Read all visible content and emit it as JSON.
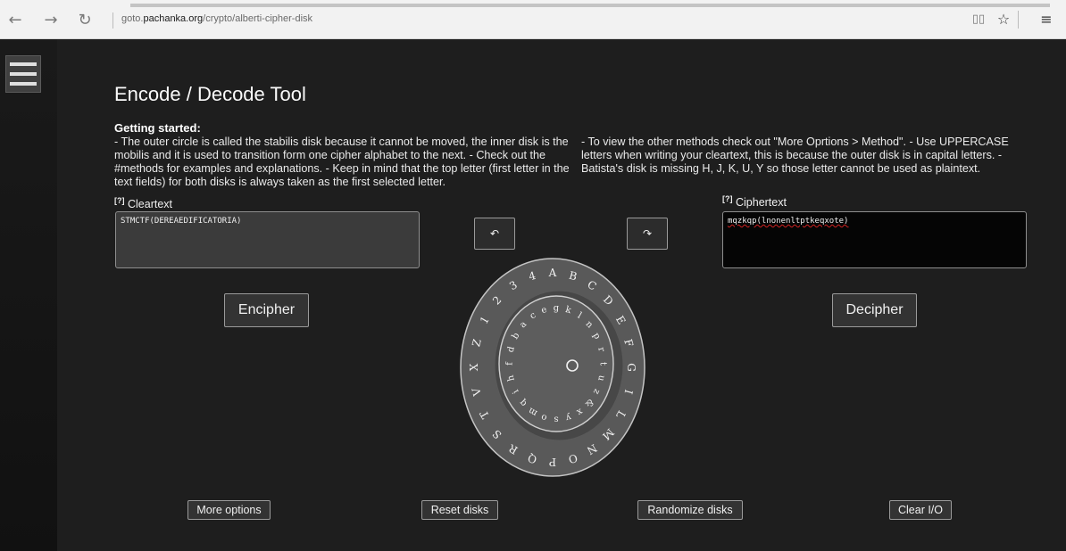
{
  "browser": {
    "url_prefix": "goto.",
    "url_domain": "pachanka.org",
    "url_path": "/crypto/alberti-cipher-disk",
    "back_icon": "←",
    "forward_icon": "→",
    "refresh_icon": "↻",
    "reading_icon": "📖",
    "favorite_icon": "☆",
    "hub_icon": "≡"
  },
  "page": {
    "title": "Encode / Decode Tool",
    "getting_started_title": "Getting started:",
    "getting_started_left": "- The outer circle is called the stabilis disk because it cannot be moved, the inner disk is the mobilis and it is used to transition form one cipher alphabet to the next. - Check out the #methods for examples and explanations. - Keep in mind that the top letter (first letter in the text fields) for both disks is always taken as the first selected letter.",
    "getting_started_right": "- To view the other methods check out \"More Oprtions > Method\". - Use UPPERCASE letters when writing your cleartext, this is because the outer disk is in capital letters. - Batista's disk is missing H, J, K, U, Y so those letter cannot be used as plaintext.",
    "help_marker": "[?]",
    "cleartext_label": "Cleartext",
    "ciphertext_label": "Ciphertext",
    "cleartext_value": "STMCTF(DEREAEDIFICATORIA)",
    "ciphertext_value": "mqzkqp(lnonenltptkeqxote)",
    "encipher_label": "Encipher",
    "decipher_label": "Decipher",
    "rotate_left_icon": "↶",
    "rotate_right_icon": "↷",
    "more_options_label": "More options",
    "reset_disks_label": "Reset disks",
    "randomize_disks_label": "Randomize disks",
    "clear_io_label": "Clear I/O"
  },
  "disk": {
    "outer_letters": [
      "A",
      "B",
      "C",
      "D",
      "E",
      "F",
      "G",
      "I",
      "L",
      "M",
      "N",
      "O",
      "P",
      "Q",
      "R",
      "S",
      "T",
      "V",
      "X",
      "Z",
      "1",
      "2",
      "3",
      "4"
    ],
    "inner_letters": [
      "g",
      "k",
      "l",
      "n",
      "p",
      "r",
      "t",
      "u",
      "z",
      "&",
      "x",
      "y",
      "s",
      "o",
      "m",
      "q",
      "i",
      "h",
      "f",
      "d",
      "b",
      "a",
      "c",
      "e"
    ],
    "center_icon": "○"
  },
  "colors": {
    "background": "#1e1e1e",
    "disk_fill": "#595959",
    "disk_stroke": "#bdbdbd",
    "text": "#e8e8e8"
  }
}
